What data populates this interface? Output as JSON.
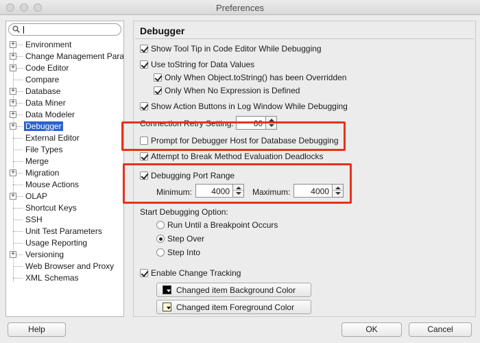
{
  "window": {
    "title": "Preferences"
  },
  "search": {
    "value": ""
  },
  "tree": [
    {
      "label": "Environment",
      "expandable": true
    },
    {
      "label": "Change Management Param",
      "expandable": true
    },
    {
      "label": "Code Editor",
      "expandable": true
    },
    {
      "label": "Compare",
      "expandable": false
    },
    {
      "label": "Database",
      "expandable": true
    },
    {
      "label": "Data Miner",
      "expandable": true
    },
    {
      "label": "Data Modeler",
      "expandable": true
    },
    {
      "label": "Debugger",
      "expandable": true,
      "selected": true
    },
    {
      "label": "External Editor",
      "expandable": false
    },
    {
      "label": "File Types",
      "expandable": false
    },
    {
      "label": "Merge",
      "expandable": false
    },
    {
      "label": "Migration",
      "expandable": true
    },
    {
      "label": "Mouse Actions",
      "expandable": false
    },
    {
      "label": "OLAP",
      "expandable": true
    },
    {
      "label": "Shortcut Keys",
      "expandable": false
    },
    {
      "label": "SSH",
      "expandable": false
    },
    {
      "label": "Unit Test Parameters",
      "expandable": false
    },
    {
      "label": "Usage Reporting",
      "expandable": false
    },
    {
      "label": "Versioning",
      "expandable": true
    },
    {
      "label": "Web Browser and Proxy",
      "expandable": false
    },
    {
      "label": "XML Schemas",
      "expandable": false
    }
  ],
  "debugger": {
    "heading": "Debugger",
    "show_tooltip": {
      "label": "Show Tool Tip in Code Editor While Debugging",
      "checked": true
    },
    "use_tostring": {
      "label": "Use toString for Data Values",
      "checked": true
    },
    "only_when_overridden": {
      "label": "Only When Object.toString() has been Overridden",
      "checked": true
    },
    "only_when_no_expression": {
      "label": "Only When No Expression is Defined",
      "checked": true
    },
    "show_action_buttons": {
      "label": "Show Action Buttons in Log Window While Debugging",
      "checked": true
    },
    "connection_retry": {
      "label": "Connection Retry Setting:",
      "value": "60"
    },
    "prompt_debugger_host": {
      "label": "Prompt for Debugger Host for Database Debugging",
      "checked": false
    },
    "attempt_break": {
      "label": "Attempt to Break Method Evaluation Deadlocks",
      "checked": true
    },
    "port_range": {
      "label": "Debugging Port Range",
      "checked": true
    },
    "minimum": {
      "label": "Minimum:",
      "value": "4000"
    },
    "maximum": {
      "label": "Maximum:",
      "value": "4000"
    },
    "start_option_label": "Start Debugging Option:",
    "start_options": [
      {
        "label": "Run Until a Breakpoint Occurs",
        "selected": false
      },
      {
        "label": "Step Over",
        "selected": true
      },
      {
        "label": "Step Into",
        "selected": false
      }
    ],
    "change_tracking": {
      "label": "Enable Change Tracking",
      "checked": true
    },
    "bg_color_button": "Changed item Background Color",
    "fg_color_button": "Changed item Foreground Color",
    "colors": {
      "background_swatch": "#000000",
      "foreground_swatch": "#fffbd6",
      "highlight": "#e8311a",
      "selection": "#2a62cc"
    }
  },
  "buttons": {
    "help": "Help",
    "ok": "OK",
    "cancel": "Cancel"
  }
}
